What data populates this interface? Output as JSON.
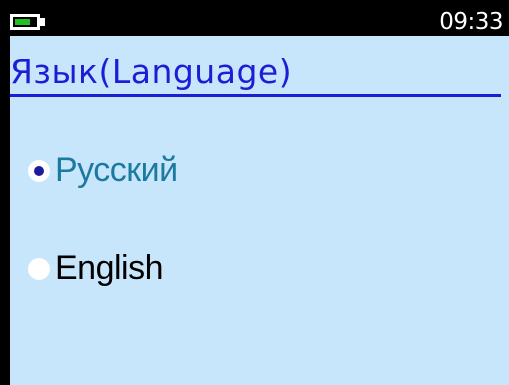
{
  "status_bar": {
    "time": "09:33",
    "battery_level": 0.75,
    "battery_color": "#22c022"
  },
  "screen": {
    "title": "Язык(Language)",
    "title_color": "#1d1dd6",
    "background_color": "#c8e6fb"
  },
  "languages": {
    "options": [
      {
        "label": "Русский",
        "selected": true,
        "color": "#1b7aa0"
      },
      {
        "label": "English",
        "selected": false,
        "color": "#000000"
      }
    ]
  }
}
